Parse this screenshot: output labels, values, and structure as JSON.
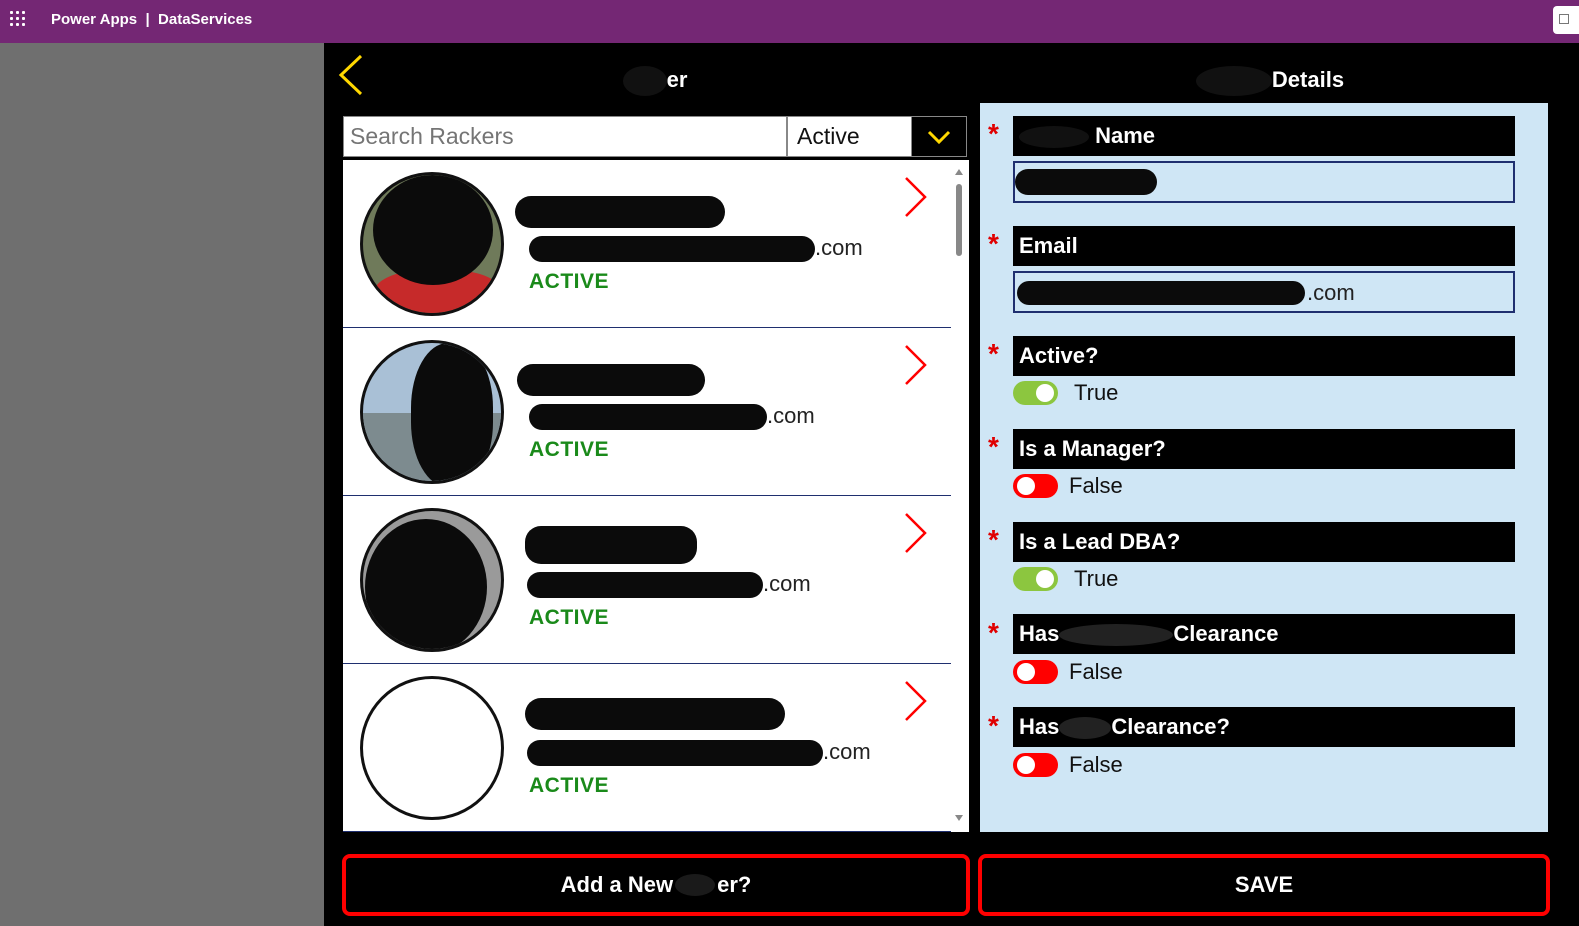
{
  "topbar": {
    "app_name": "Power Apps",
    "separator": "|",
    "environment": "DataServices"
  },
  "screen": {
    "left_title_suffix": "er",
    "right_title_suffix": "Details"
  },
  "search": {
    "placeholder": "Search Rackers",
    "value": ""
  },
  "filter": {
    "selected": "Active"
  },
  "gallery": {
    "items": [
      {
        "email_suffix": ".com",
        "status": "ACTIVE"
      },
      {
        "email_suffix": ".com",
        "status": "ACTIVE"
      },
      {
        "email_suffix": ".com",
        "status": "ACTIVE"
      },
      {
        "email_suffix": ".com",
        "status": "ACTIVE"
      }
    ]
  },
  "form": {
    "required_marker": "*",
    "name_label_suffix": "Name",
    "email_label": "Email",
    "email_suffix": ".com",
    "active_label": "Active?",
    "active_value": "True",
    "manager_label": "Is a Manager?",
    "manager_value": "False",
    "lead_dba_label": "Is a Lead DBA?",
    "lead_dba_value": "True",
    "clearance1_label_prefix": "Has",
    "clearance1_label_suffix": "Clearance",
    "clearance1_value": "False",
    "clearance2_label_prefix": "Has",
    "clearance2_label_suffix": "Clearance?",
    "clearance2_value": "False"
  },
  "buttons": {
    "add_new_prefix": "Add a New",
    "add_new_suffix": "er?",
    "save": "SAVE"
  },
  "colors": {
    "topbar": "#742774",
    "accent_yellow": "#ffd800",
    "status_green": "#1a8a1a",
    "required_red": "#e00000",
    "form_bg": "#cfe6f5"
  }
}
